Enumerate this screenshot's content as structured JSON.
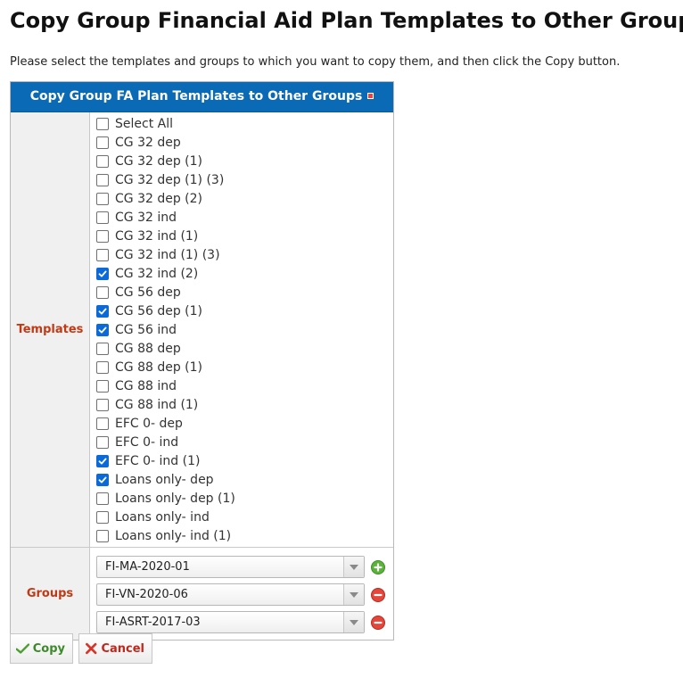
{
  "page_title": "Copy Group Financial Aid Plan Templates to Other Groups",
  "instructions": "Please select the templates and groups to which you want to copy them, and then click the Copy button.",
  "panel": {
    "title": "Copy Group FA Plan Templates to Other Groups",
    "templates_label": "Templates",
    "groups_label": "Groups"
  },
  "templates": [
    {
      "label": "Select All",
      "checked": false
    },
    {
      "label": "CG 32 dep",
      "checked": false
    },
    {
      "label": "CG 32 dep (1)",
      "checked": false
    },
    {
      "label": "CG 32 dep (1) (3)",
      "checked": false
    },
    {
      "label": "CG 32 dep (2)",
      "checked": false
    },
    {
      "label": "CG 32 ind",
      "checked": false
    },
    {
      "label": "CG 32 ind (1)",
      "checked": false
    },
    {
      "label": "CG 32 ind (1) (3)",
      "checked": false
    },
    {
      "label": "CG 32 ind (2)",
      "checked": true
    },
    {
      "label": "CG 56 dep",
      "checked": false
    },
    {
      "label": "CG 56 dep (1)",
      "checked": true
    },
    {
      "label": "CG 56 ind",
      "checked": true
    },
    {
      "label": "CG 88 dep",
      "checked": false
    },
    {
      "label": "CG 88 dep (1)",
      "checked": false
    },
    {
      "label": "CG 88 ind",
      "checked": false
    },
    {
      "label": "CG 88 ind (1)",
      "checked": false
    },
    {
      "label": "EFC 0- dep",
      "checked": false
    },
    {
      "label": "EFC 0- ind",
      "checked": false
    },
    {
      "label": "EFC 0- ind (1)",
      "checked": true
    },
    {
      "label": "Loans only- dep",
      "checked": true
    },
    {
      "label": "Loans only- dep (1)",
      "checked": false
    },
    {
      "label": "Loans only- ind",
      "checked": false
    },
    {
      "label": "Loans only- ind (1)",
      "checked": false
    }
  ],
  "groups": [
    {
      "value": "FI-MA-2020-01",
      "action_icon": "add-icon"
    },
    {
      "value": "FI-VN-2020-06",
      "action_icon": "remove-icon"
    },
    {
      "value": "FI-ASRT-2017-03",
      "action_icon": "remove-icon"
    }
  ],
  "buttons": {
    "copy_label": "Copy",
    "cancel_label": "Cancel"
  },
  "colors": {
    "header_bg": "#0b6ab5",
    "label_red": "#c23a15",
    "checkbox_blue": "#0b6ad8",
    "add_green": "#5bb33a",
    "remove_red": "#e5463a"
  }
}
